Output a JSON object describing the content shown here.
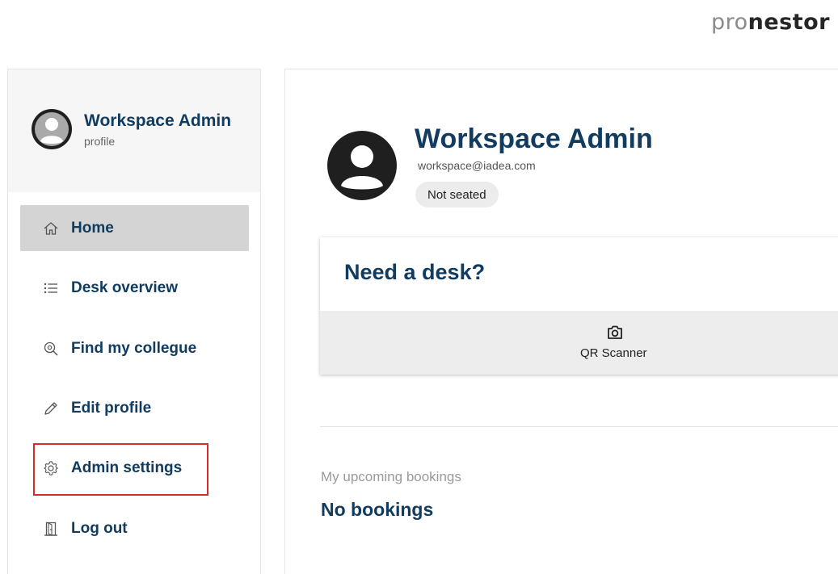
{
  "logo": {
    "part1": "pro",
    "part2": "nestor"
  },
  "sidebar": {
    "profile_name": "Workspace Admin",
    "profile_sub": "profile",
    "items": [
      {
        "label": "Home",
        "icon": "home-icon",
        "active": true
      },
      {
        "label": "Desk overview",
        "icon": "list-icon",
        "active": false
      },
      {
        "label": "Find my collegue",
        "icon": "search-icon",
        "active": false
      },
      {
        "label": "Edit profile",
        "icon": "pencil-icon",
        "active": false
      },
      {
        "label": "Admin settings",
        "icon": "gear-icon",
        "active": false
      },
      {
        "label": "Log out",
        "icon": "door-icon",
        "active": false
      }
    ]
  },
  "main": {
    "name": "Workspace Admin",
    "email": "workspace@iadea.com",
    "status": "Not seated",
    "desk_card": {
      "title": "Need a desk?",
      "button_label": "QR Scanner",
      "button_icon": "camera-icon"
    },
    "bookings": {
      "label": "My upcoming bookings",
      "empty_text": "No bookings"
    }
  },
  "colors": {
    "primary": "#113c60",
    "active_nav": "#d4d4d4",
    "highlight": "#d62c2c"
  }
}
